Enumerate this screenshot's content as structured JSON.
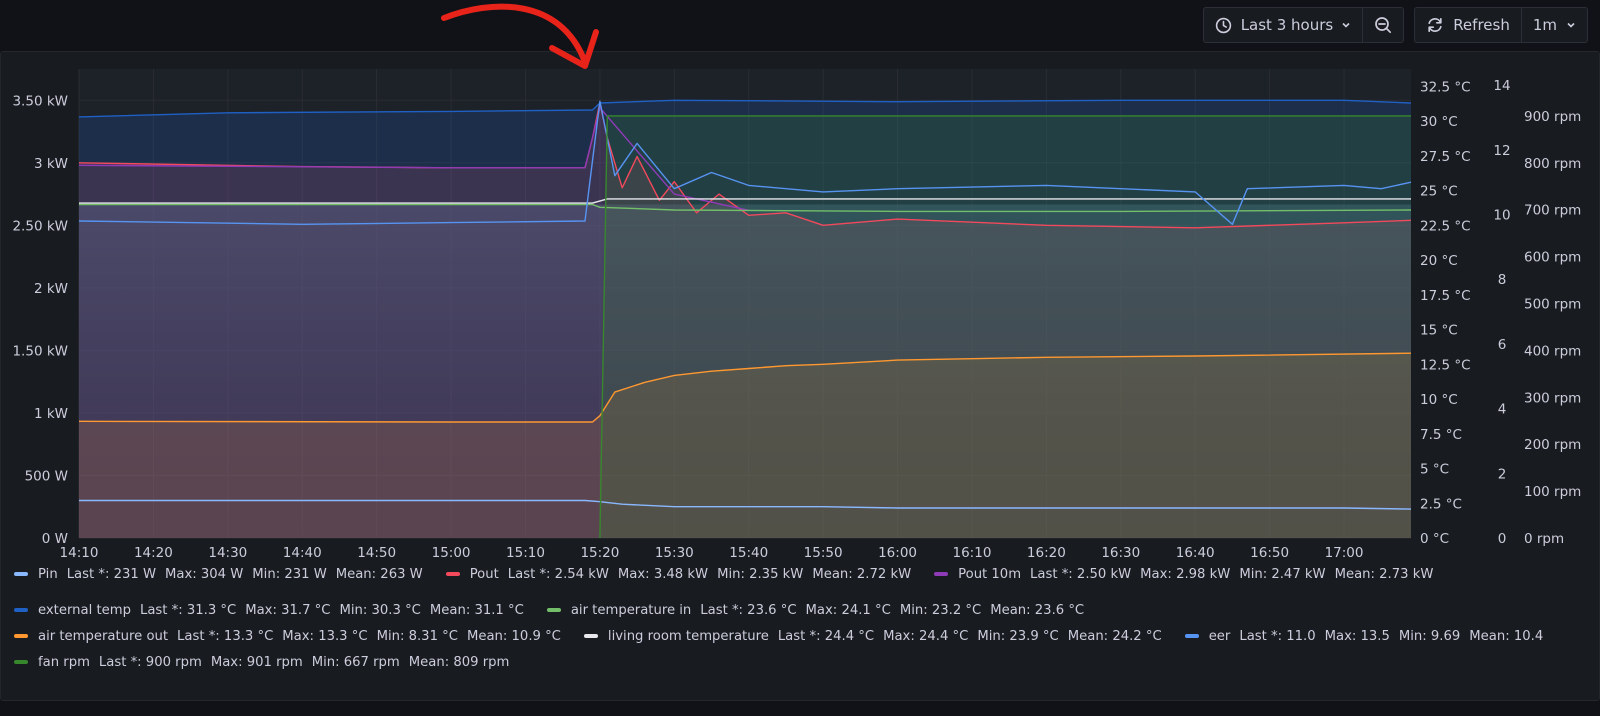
{
  "toolbar": {
    "time_range_label": "Last 3 hours",
    "refresh_label": "Refresh",
    "refresh_interval": "1m",
    "icons": [
      "clock-icon",
      "chevron-down-icon",
      "zoom-out-icon",
      "refresh-icon",
      "chevron-down-icon"
    ]
  },
  "chart_data": {
    "type": "line",
    "x_ticks": [
      "14:10",
      "14:20",
      "14:30",
      "14:40",
      "14:50",
      "15:00",
      "15:10",
      "15:20",
      "15:30",
      "15:40",
      "15:50",
      "16:00",
      "16:10",
      "16:20",
      "16:30",
      "16:40",
      "16:50",
      "17:00"
    ],
    "xlim": [
      "14:10",
      "17:09"
    ],
    "axes": {
      "power": {
        "side": "left",
        "ylim": [
          0,
          3.75
        ],
        "unit": "kW",
        "ticks": [
          "0 W",
          "500 W",
          "1 kW",
          "1.50 kW",
          "2 kW",
          "2.50 kW",
          "3 kW",
          "3.50 kW"
        ]
      },
      "temperature": {
        "side": "right",
        "ylim": [
          0,
          33.75
        ],
        "unit": "°C",
        "ticks": [
          "0 °C",
          "2.5 °C",
          "5 °C",
          "7.5 °C",
          "10 °C",
          "12.5 °C",
          "15 °C",
          "17.5 °C",
          "20 °C",
          "22.5 °C",
          "25 °C",
          "27.5 °C",
          "30 °C",
          "32.5 °C"
        ]
      },
      "eer": {
        "side": "right",
        "ylim": [
          0,
          14.5
        ],
        "unit": "",
        "ticks": [
          "0",
          "2",
          "4",
          "6",
          "8",
          "10",
          "12",
          "14"
        ]
      },
      "fan": {
        "side": "right",
        "ylim": [
          0,
          1000
        ],
        "unit": "rpm",
        "ticks": [
          "0 rpm",
          "100 rpm",
          "200 rpm",
          "300 rpm",
          "400 rpm",
          "500 rpm",
          "600 rpm",
          "700 rpm",
          "800 rpm",
          "900 rpm"
        ]
      }
    },
    "grid": true,
    "legend_position": "bottom",
    "series": [
      {
        "name": "Pin",
        "color": "#8ab8ff",
        "axis": "power",
        "unit": "kW",
        "x": [
          "14:10",
          "15:00",
          "15:18",
          "15:20",
          "15:23",
          "15:30",
          "15:40",
          "15:50",
          "16:00",
          "16:30",
          "17:00",
          "17:09"
        ],
        "y": [
          0.3,
          0.3,
          0.3,
          0.29,
          0.27,
          0.25,
          0.25,
          0.25,
          0.24,
          0.24,
          0.24,
          0.231
        ],
        "legend": {
          "last": "Last *: 231 W",
          "max": "Max: 304 W",
          "min": "Min: 231 W",
          "mean": "Mean: 263 W"
        }
      },
      {
        "name": "Pout",
        "color": "#f2495c",
        "axis": "power",
        "unit": "kW",
        "x": [
          "14:10",
          "14:40",
          "15:00",
          "15:18",
          "15:19",
          "15:20",
          "15:21",
          "15:23",
          "15:25",
          "15:28",
          "15:30",
          "15:33",
          "15:36",
          "15:40",
          "15:45",
          "15:50",
          "16:00",
          "16:20",
          "16:40",
          "17:00",
          "17:09"
        ],
        "y": [
          3.0,
          2.97,
          2.96,
          2.96,
          3.2,
          3.48,
          3.2,
          2.8,
          3.05,
          2.7,
          2.85,
          2.6,
          2.75,
          2.58,
          2.6,
          2.5,
          2.55,
          2.5,
          2.48,
          2.52,
          2.54
        ],
        "legend": {
          "last": "Last *: 2.54 kW",
          "max": "Max: 3.48 kW",
          "min": "Min: 2.35 kW",
          "mean": "Mean: 2.72 kW"
        }
      },
      {
        "name": "Pout 10m",
        "color": "#8f3bb8",
        "axis": "power",
        "unit": "kW",
        "x": [
          "14:10",
          "15:00",
          "15:18",
          "15:20",
          "15:30",
          "15:40"
        ],
        "y": [
          2.98,
          2.96,
          2.96,
          3.44,
          2.75,
          2.62
        ],
        "legend": {
          "last": "Last *: 2.50 kW",
          "max": "Max: 2.98 kW",
          "min": "Min: 2.47 kW",
          "mean": "Mean: 2.73 kW"
        }
      },
      {
        "name": "external temp",
        "color": "#1f60c4",
        "axis": "temperature",
        "unit": "°C",
        "x": [
          "14:10",
          "14:30",
          "15:00",
          "15:19",
          "15:20",
          "15:30",
          "16:00",
          "16:30",
          "17:00",
          "17:09"
        ],
        "y": [
          30.3,
          30.6,
          30.7,
          30.8,
          31.3,
          31.5,
          31.4,
          31.5,
          31.5,
          31.3
        ],
        "legend": {
          "last": "Last *: 31.3 °C",
          "max": "Max: 31.7 °C",
          "min": "Min: 30.3 °C",
          "mean": "Mean: 31.1 °C"
        }
      },
      {
        "name": "air temperature in",
        "color": "#73bf69",
        "axis": "temperature",
        "unit": "°C",
        "x": [
          "14:10",
          "15:00",
          "15:19",
          "15:20",
          "15:30",
          "16:00",
          "16:30",
          "17:09"
        ],
        "y": [
          24.0,
          24.0,
          24.0,
          23.8,
          23.6,
          23.5,
          23.5,
          23.6
        ],
        "legend": {
          "last": "Last *: 23.6 °C",
          "max": "Max: 24.1 °C",
          "min": "Min: 23.2 °C",
          "mean": "Mean: 23.6 °C"
        }
      },
      {
        "name": "air temperature out",
        "color": "#ff9830",
        "axis": "temperature",
        "unit": "°C",
        "x": [
          "14:10",
          "15:00",
          "15:19",
          "15:20",
          "15:22",
          "15:26",
          "15:30",
          "15:35",
          "15:40",
          "15:45",
          "15:50",
          "16:00",
          "16:10",
          "16:20",
          "16:40",
          "17:09"
        ],
        "y": [
          8.4,
          8.35,
          8.35,
          8.8,
          10.5,
          11.2,
          11.7,
          12.0,
          12.2,
          12.4,
          12.5,
          12.8,
          12.9,
          13.0,
          13.1,
          13.3
        ],
        "legend": {
          "last": "Last *: 13.3 °C",
          "max": "Max: 13.3 °C",
          "min": "Min: 8.31 °C",
          "mean": "Mean: 10.9 °C"
        }
      },
      {
        "name": "living room temperature",
        "color": "#e8e8ed",
        "axis": "temperature",
        "unit": "°C",
        "x": [
          "14:10",
          "15:00",
          "15:19",
          "15:21",
          "15:40",
          "16:30",
          "17:09"
        ],
        "y": [
          24.1,
          24.1,
          24.1,
          24.4,
          24.4,
          24.4,
          24.4
        ],
        "legend": {
          "last": "Last *: 24.4 °C",
          "max": "Max: 24.4 °C",
          "min": "Min: 23.9 °C",
          "mean": "Mean: 24.2 °C"
        }
      },
      {
        "name": "eer",
        "color": "#5794f2",
        "axis": "eer",
        "unit": "",
        "x": [
          "14:10",
          "14:40",
          "15:00",
          "15:18",
          "15:20",
          "15:22",
          "15:25",
          "15:30",
          "15:35",
          "15:40",
          "15:50",
          "16:00",
          "16:20",
          "16:40",
          "16:45",
          "16:47",
          "17:00",
          "17:05",
          "17:09"
        ],
        "y": [
          9.8,
          9.7,
          9.75,
          9.8,
          13.5,
          11.2,
          12.2,
          10.8,
          11.3,
          10.9,
          10.7,
          10.8,
          10.9,
          10.7,
          9.7,
          10.8,
          10.9,
          10.8,
          11.0
        ],
        "legend": {
          "last": "Last *: 11.0",
          "max": "Max: 13.5",
          "min": "Min: 9.69",
          "mean": "Mean: 10.4"
        }
      },
      {
        "name": "fan rpm",
        "color": "#37872d",
        "axis": "fan",
        "unit": "rpm",
        "x": [
          "15:20",
          "15:21",
          "16:00",
          "16:30",
          "17:09"
        ],
        "y": [
          0,
          900,
          900,
          900,
          900
        ],
        "legend": {
          "last": "Last *: 900 rpm",
          "max": "Max: 901 rpm",
          "min": "Min: 667 rpm",
          "mean": "Mean: 809 rpm"
        }
      }
    ],
    "annotation": {
      "type": "red-arrow",
      "points_to": "15:20"
    }
  },
  "legend_rows": [
    [
      0,
      1,
      2
    ],
    [
      3,
      4
    ],
    [
      5,
      6,
      7
    ],
    [
      8
    ]
  ]
}
